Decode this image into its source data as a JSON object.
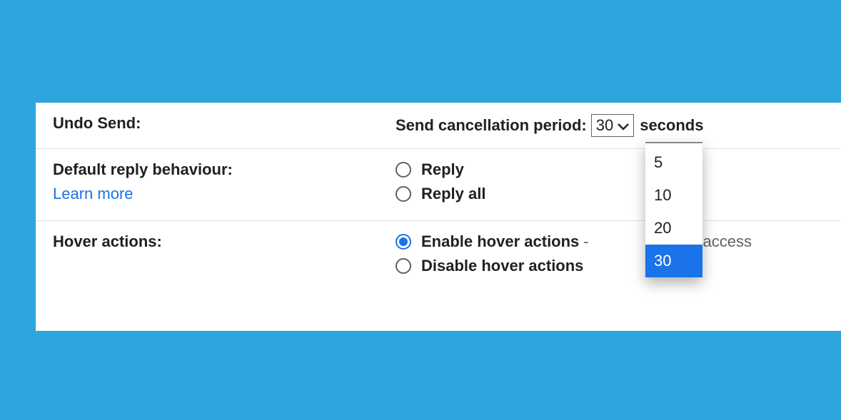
{
  "undoSend": {
    "label": "Undo Send:",
    "cancellationLabel": "Send cancellation period:",
    "selectedValue": "30",
    "unit": "seconds",
    "options": [
      "5",
      "10",
      "20",
      "30"
    ]
  },
  "defaultReply": {
    "label": "Default reply behaviour:",
    "learnMore": "Learn more",
    "replyOption": "Reply",
    "replyAllOption": "Reply all"
  },
  "hoverActions": {
    "label": "Hover actions:",
    "enableOption": "Enable hover actions",
    "enableHint": "- Quickly gain access",
    "middleFragment": "/ gain access",
    "disableOption": "Disable hover actions"
  }
}
